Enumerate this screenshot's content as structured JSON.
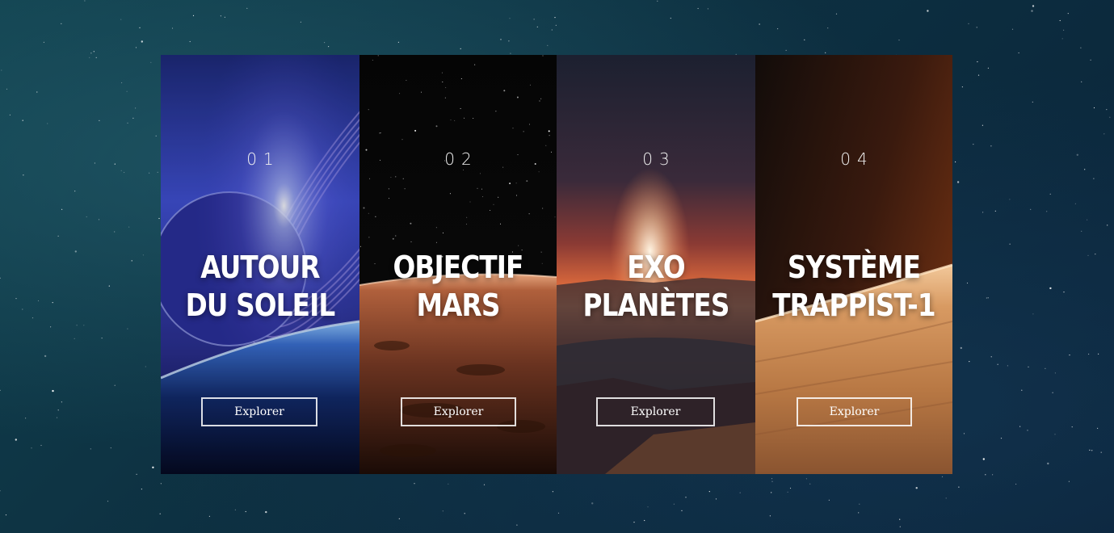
{
  "cards": [
    {
      "number": "01",
      "title_line1": "AUTOUR",
      "title_line2": "DU SOLEIL",
      "button_label": "Explorer",
      "theme": "blue-ringed-planet",
      "accent": "#3f48c4"
    },
    {
      "number": "02",
      "title_line1": "OBJECTIF",
      "title_line2": "MARS",
      "button_label": "Explorer",
      "theme": "mars-horizon",
      "accent": "#b5623a"
    },
    {
      "number": "03",
      "title_line1": "EXO",
      "title_line2": "PLANÈTES",
      "button_label": "Explorer",
      "theme": "exoplanet-sunset",
      "accent": "#e0683a"
    },
    {
      "number": "04",
      "title_line1": "SYSTÈME",
      "title_line2": "TRAPPIST-1",
      "button_label": "Explorer",
      "theme": "trappist-desert",
      "accent": "#c98a52"
    }
  ]
}
